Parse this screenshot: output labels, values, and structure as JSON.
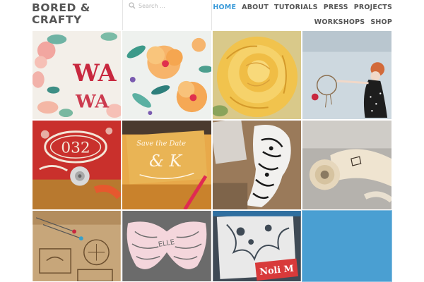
{
  "site": {
    "logo": "BORED & CRAFTY"
  },
  "search": {
    "placeholder": "Search ..."
  },
  "nav": {
    "row1": [
      {
        "label": "HOME",
        "active": true
      },
      {
        "label": "ABOUT"
      },
      {
        "label": "TUTORIALS"
      },
      {
        "label": "PRESS"
      },
      {
        "label": "PROJECTS"
      }
    ],
    "row2": [
      {
        "label": "WORKSHOPS"
      },
      {
        "label": "SHOP"
      }
    ]
  },
  "tiles": {
    "watercolor_lettering": "WA",
    "stamp_number": "032",
    "save_date": "Save the Date",
    "initials": "& K",
    "wings_label": "ELLE",
    "papercut_label": "Noli M"
  },
  "colors": {
    "accent": "#3a9ad9",
    "empty_tile": "#4a9fd2"
  }
}
